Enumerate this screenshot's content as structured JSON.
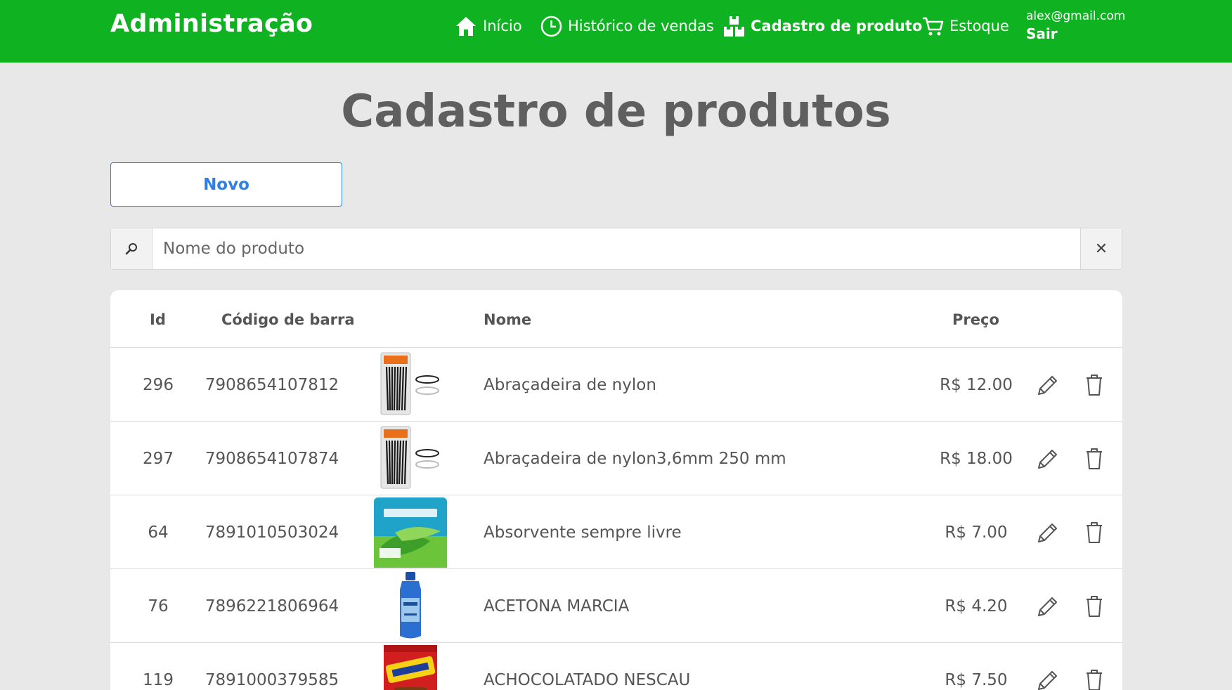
{
  "app": {
    "title": "Administração"
  },
  "nav": {
    "items": [
      {
        "label": "Início",
        "icon": "home-icon"
      },
      {
        "label": "Histórico de vendas",
        "icon": "clock-icon"
      },
      {
        "label": "Cadastro de produto",
        "icon": "boxes-icon",
        "active": true
      },
      {
        "label": "Estoque",
        "icon": "cart-icon"
      }
    ],
    "user_email": "alex@gmail.com",
    "logout_label": "Sair"
  },
  "page": {
    "title": "Cadastro de produtos",
    "new_button_label": "Novo"
  },
  "search": {
    "placeholder": "Nome do produto",
    "value": "",
    "clear_symbol": "✕"
  },
  "table": {
    "columns": [
      "Id",
      "Código de barra",
      "Nome",
      "Preço"
    ],
    "rows": [
      {
        "id": "296",
        "barcode": "7908654107812",
        "name": "Abraçadeira de nylon",
        "price": "R$ 12.00",
        "image": "cable-ties-package"
      },
      {
        "id": "297",
        "barcode": "7908654107874",
        "name": "Abraçadeira de nylon3,6mm 250 mm",
        "price": "R$ 18.00",
        "image": "cable-ties-package"
      },
      {
        "id": "64",
        "barcode": "7891010503024",
        "name": "Absorvente sempre livre",
        "price": "R$ 7.00",
        "image": "sanitary-pad-package"
      },
      {
        "id": "76",
        "barcode": "7896221806964",
        "name": "ACETONA MARCIA",
        "price": "R$ 4.20",
        "image": "acetone-bottle"
      },
      {
        "id": "119",
        "barcode": "7891000379585",
        "name": "ACHOCOLATADO NESCAU",
        "price": "R$ 7.50",
        "image": "chocolate-powder-can"
      }
    ]
  },
  "colors": {
    "navbar": "#0fb321",
    "accent": "#2f7fe6",
    "background": "#e8e8e8"
  }
}
